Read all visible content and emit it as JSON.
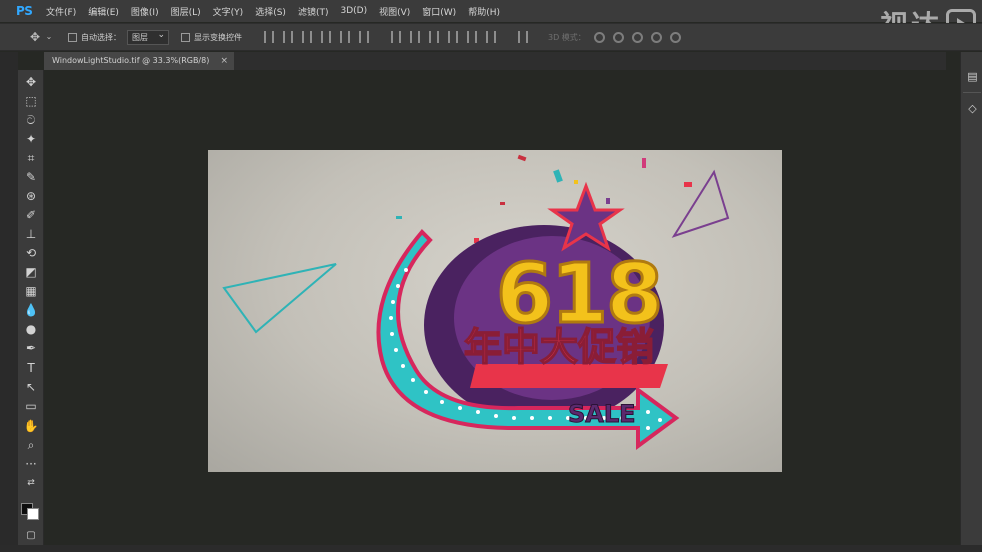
{
  "app": {
    "logo": "PS"
  },
  "menu": [
    "文件(F)",
    "编辑(E)",
    "图像(I)",
    "图层(L)",
    "文字(Y)",
    "选择(S)",
    "滤镜(T)",
    "3D(D)",
    "视图(V)",
    "窗口(W)",
    "帮助(H)"
  ],
  "watermark": {
    "text": "视达"
  },
  "options": {
    "auto_select_label": "自动选择：",
    "auto_select_value": "图层",
    "show_transform_label": "显示变换控件",
    "mode3d_label": "3D 模式："
  },
  "document": {
    "tab_title": "WindowLightStudio.tif @ 33.3%(RGB/8)",
    "close_glyph": "×"
  },
  "artwork": {
    "number": "618",
    "headline": "年中大促销",
    "sale": "SALE"
  },
  "colors": {
    "accent_blue": "#31a8ff",
    "canvas_bg": "#c3c0b8",
    "yellow": "#f3c21b",
    "purple": "#5b2a6e",
    "red": "#e8344a",
    "teal": "#2fc3c5"
  },
  "tools": [
    "move-icon",
    "marquee-icon",
    "lasso-icon",
    "magic-wand-icon",
    "crop-icon",
    "eyedropper-icon",
    "healing-icon",
    "brush-icon",
    "stamp-icon",
    "history-brush-icon",
    "eraser-icon",
    "gradient-icon",
    "blur-icon",
    "dodge-icon",
    "pen-icon",
    "type-icon",
    "path-select-icon",
    "shape-icon",
    "hand-icon",
    "zoom-icon",
    "more-icon"
  ]
}
